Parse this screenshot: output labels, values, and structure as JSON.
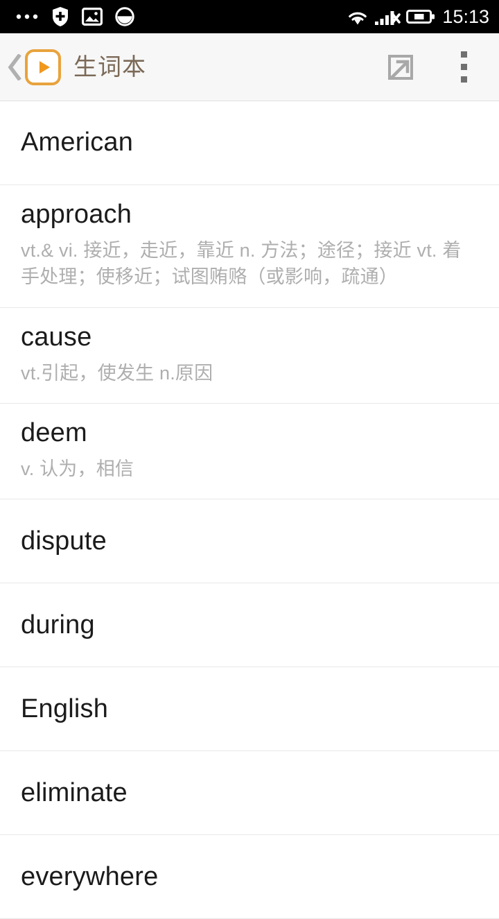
{
  "status_bar": {
    "icons_left": [
      "more-dots-icon",
      "security-shield-icon",
      "screenshot-image-icon",
      "do-not-disturb-icon"
    ],
    "icons_right": [
      "wifi-icon",
      "signal-no-sim-icon",
      "battery-icon"
    ],
    "time": "15:13",
    "background_color": "#000000",
    "foreground_color": "#ffffff"
  },
  "app_bar": {
    "back_icon": "chevron-left-icon",
    "logo_icon": "play-button-logo",
    "title": "生词本",
    "title_color": "#7b6a58",
    "accent_color": "#e8a33d",
    "actions": [
      {
        "name": "export-share-icon",
        "icon": "arrow-out-of-box-icon"
      },
      {
        "name": "overflow-menu-icon",
        "icon": "three-dots-vertical-icon"
      }
    ],
    "background_color": "#f7f7f7"
  },
  "word_list": {
    "items": [
      {
        "term": "American",
        "definition": ""
      },
      {
        "term": "approach",
        "definition": "vt.& vi. 接近，走近，靠近  n. 方法；途径；接近 vt. 着手处理；使移近；试图贿赂（或影响，疏通）"
      },
      {
        "term": "cause",
        "definition": "vt.引起，使发生  n.原因"
      },
      {
        "term": "deem",
        "definition": "v. 认为，相信"
      },
      {
        "term": "dispute",
        "definition": ""
      },
      {
        "term": "during",
        "definition": ""
      },
      {
        "term": "English",
        "definition": ""
      },
      {
        "term": "eliminate",
        "definition": ""
      },
      {
        "term": "everywhere",
        "definition": ""
      }
    ]
  }
}
